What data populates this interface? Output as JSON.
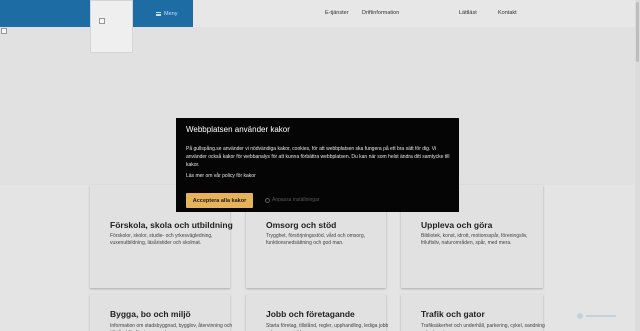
{
  "header": {
    "menu_label": "Meny",
    "nav": [
      "E-tjänster",
      "Driftinformation",
      "Lättläst",
      "Kontakt"
    ]
  },
  "colors": {
    "brand": "#1e6fa8",
    "accept": "#e6b35a",
    "dialog_bg": "#050505"
  },
  "cards": [
    {
      "title": "Förskola, skola och utbildning",
      "desc": "Förskolor, skolor, studie- och yrkesvägledning, vuxenutbildning, läsåristider och skolmat."
    },
    {
      "title": "Omsorg och stöd",
      "desc": "Trygghet, försörjningsstöd, vård och omsorg, funktionsnedsättning och god man."
    },
    {
      "title": "Uppleva och göra",
      "desc": "Bibliotek, konst, idrott, motionsspår, föreningsliv, friluftsliv, naturområden, spår, med mera."
    },
    {
      "title": "Bygga, bo och miljö",
      "desc": "Information om stadsbyggnad, bygglov, återvinning och tillstånd för företagare och"
    },
    {
      "title": "Jobb och företagande",
      "desc": "Starta företag, tillstånd, regler, upphandling, lediga jobb och sommarjobb."
    },
    {
      "title": "Trafik och gator",
      "desc": "Trafiksäkerhet och underhåll, parkering, cykel, sandning och plogning"
    }
  ],
  "cookie": {
    "title": "Webbplatsen använder kakor",
    "text": "På gullspång.se använder vi nödvändiga kakor, cookies, för att webbplatsen ska fungera på ett bra sätt för dig. Vi använder också kakor för webbanalys för att kunna förbättra webbplatsen. Du kan när som helst ändra ditt samtycke till kakor.",
    "policy_link": "Läs mer om vår policy för kakor",
    "accept_label": "Acceptera alla kakor",
    "customize_label": "Anpassa inställningar"
  },
  "icons": {
    "menu": "hamburger-icon",
    "customize": "gear-icon",
    "logo": "broken-image-icon",
    "hero": "broken-image-icon"
  }
}
